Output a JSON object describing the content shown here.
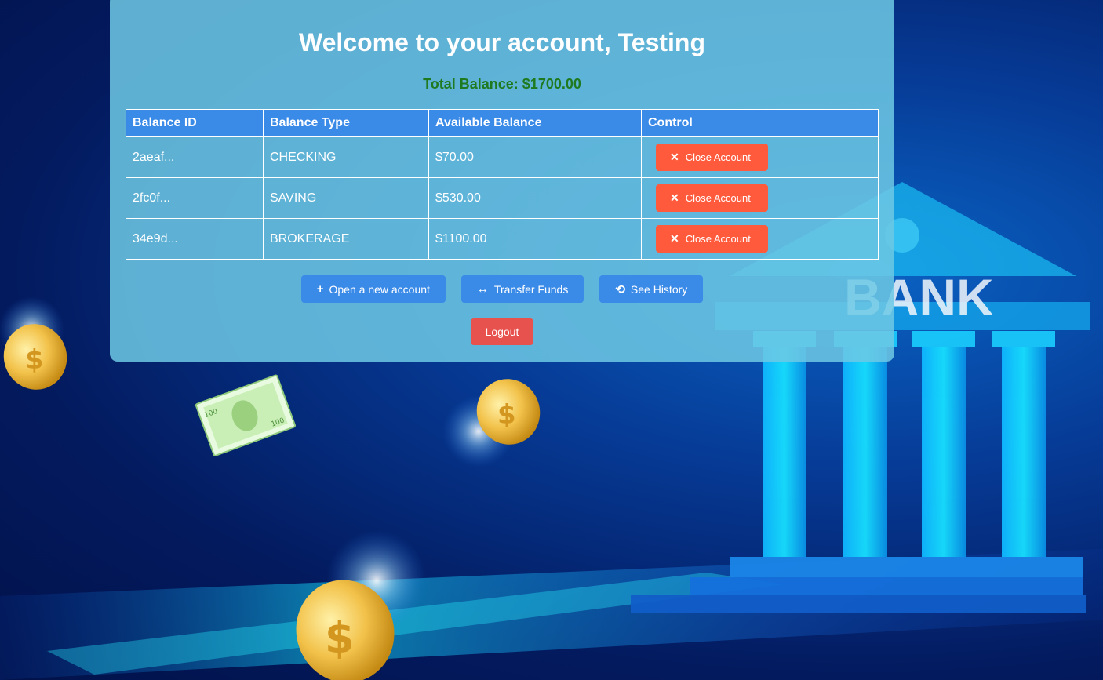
{
  "header": {
    "title": "Welcome to your account, Testing",
    "total_balance": "Total Balance: $1700.00"
  },
  "table": {
    "columns": [
      "Balance ID",
      "Balance Type",
      "Available Balance",
      "Control"
    ],
    "rows": [
      {
        "id": "2aeaf...",
        "type": "CHECKING",
        "balance": "$70.00",
        "control": "Close Account"
      },
      {
        "id": "2fc0f...",
        "type": "SAVING",
        "balance": "$530.00",
        "control": "Close Account"
      },
      {
        "id": "34e9d...",
        "type": "BROKERAGE",
        "balance": "$1100.00",
        "control": "Close Account"
      }
    ]
  },
  "actions": {
    "open_account": "Open a new account",
    "transfer": "Transfer Funds",
    "history": "See History"
  },
  "logout_label": "Logout",
  "background": {
    "bank_sign": "BANK",
    "banknote_value": "100"
  },
  "icons": {
    "close": "close-icon",
    "open": "plus-icon",
    "transfer": "arrows-horizontal-icon",
    "history": "history-icon"
  },
  "colors": {
    "primary": "#3a8ae8",
    "danger": "#ff5a3c",
    "logout": "#e8524e",
    "balance_text": "#1f7a1f"
  }
}
